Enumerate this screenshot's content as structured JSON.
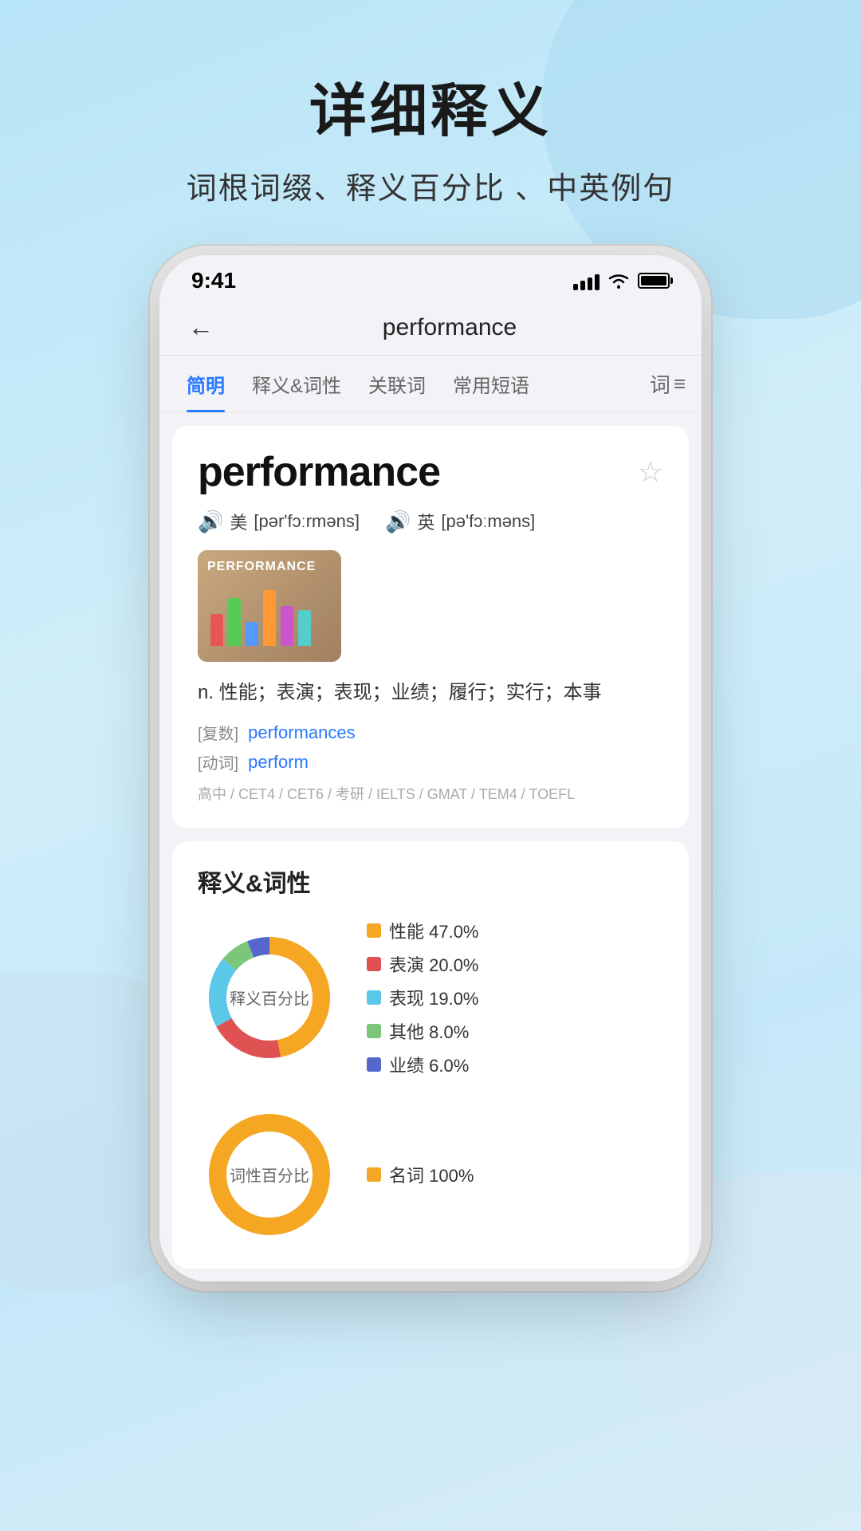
{
  "page": {
    "title": "详细释义",
    "subtitle": "词根词缀、释义百分比 、中英例句"
  },
  "status_bar": {
    "time": "9:41",
    "signal": "signal-icon",
    "wifi": "wifi-icon",
    "battery": "battery-icon"
  },
  "nav": {
    "back_label": "←",
    "title": "performance"
  },
  "tabs": [
    {
      "id": "jianming",
      "label": "简明",
      "active": true
    },
    {
      "id": "yiyi",
      "label": "释义&词性",
      "active": false
    },
    {
      "id": "guanlian",
      "label": "关联词",
      "active": false
    },
    {
      "id": "changyong",
      "label": "常用短语",
      "active": false
    },
    {
      "id": "more",
      "label": "词",
      "active": false
    }
  ],
  "word_card": {
    "word": "performance",
    "star_label": "☆",
    "pronunciation_us_icon": "🔊",
    "pronunciation_us_label": "美",
    "pronunciation_us_ipa": "[pər'fɔːrməns]",
    "pronunciation_uk_icon": "🔊",
    "pronunciation_uk_label": "英",
    "pronunciation_uk_ipa": "[pə'fɔːməns]",
    "image_text": "PERFORMANCE",
    "definition": "n.  性能；表演；表现；业绩；履行；实行；本事",
    "plural_label": "[复数]",
    "plural_value": "performances",
    "verb_label": "[动词]",
    "verb_value": "perform",
    "tags": "高中 / CET4 / CET6 / 考研 / IELTS / GMAT / TEM4 / TOEFL"
  },
  "definition_section": {
    "title": "释义&词性",
    "donut1": {
      "center_label": "释义百分比",
      "legend": [
        {
          "color": "#F5A623",
          "label": "性能 47.0%"
        },
        {
          "color": "#E05252",
          "label": "表演 20.0%"
        },
        {
          "color": "#5BC8E8",
          "label": "表现 19.0%"
        },
        {
          "color": "#7BC67A",
          "label": "其他 8.0%"
        },
        {
          "color": "#5566CC",
          "label": "业绩 6.0%"
        }
      ],
      "segments": [
        {
          "color": "#F5A623",
          "pct": 47
        },
        {
          "color": "#E05252",
          "pct": 20
        },
        {
          "color": "#5BC8E8",
          "pct": 19
        },
        {
          "color": "#7BC67A",
          "pct": 8
        },
        {
          "color": "#5566CC",
          "pct": 6
        }
      ]
    },
    "donut2": {
      "center_label": "词性百分比",
      "legend": [
        {
          "color": "#F5A623",
          "label": "名词 100%"
        }
      ],
      "segments": [
        {
          "color": "#F5A623",
          "pct": 100
        }
      ]
    }
  }
}
